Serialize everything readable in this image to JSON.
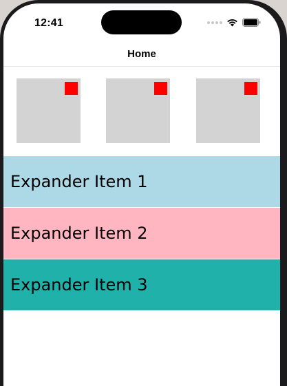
{
  "status_bar": {
    "time": "12:41",
    "icons": [
      "cellular-signal-icon",
      "wifi-icon",
      "battery-icon"
    ]
  },
  "nav": {
    "title": "Home"
  },
  "tiles": [
    {
      "name": "tile-1",
      "color": "#d3d3d3",
      "marker_color": "#ff0000"
    },
    {
      "name": "tile-2",
      "color": "#d3d3d3",
      "marker_color": "#ff0000"
    },
    {
      "name": "tile-3",
      "color": "#d3d3d3",
      "marker_color": "#ff0000"
    }
  ],
  "expanders": [
    {
      "label": "Expander Item 1",
      "color": "#add8e6"
    },
    {
      "label": "Expander Item 2",
      "color": "#ffb6c1"
    },
    {
      "label": "Expander Item 3",
      "color": "#20b2aa"
    }
  ]
}
